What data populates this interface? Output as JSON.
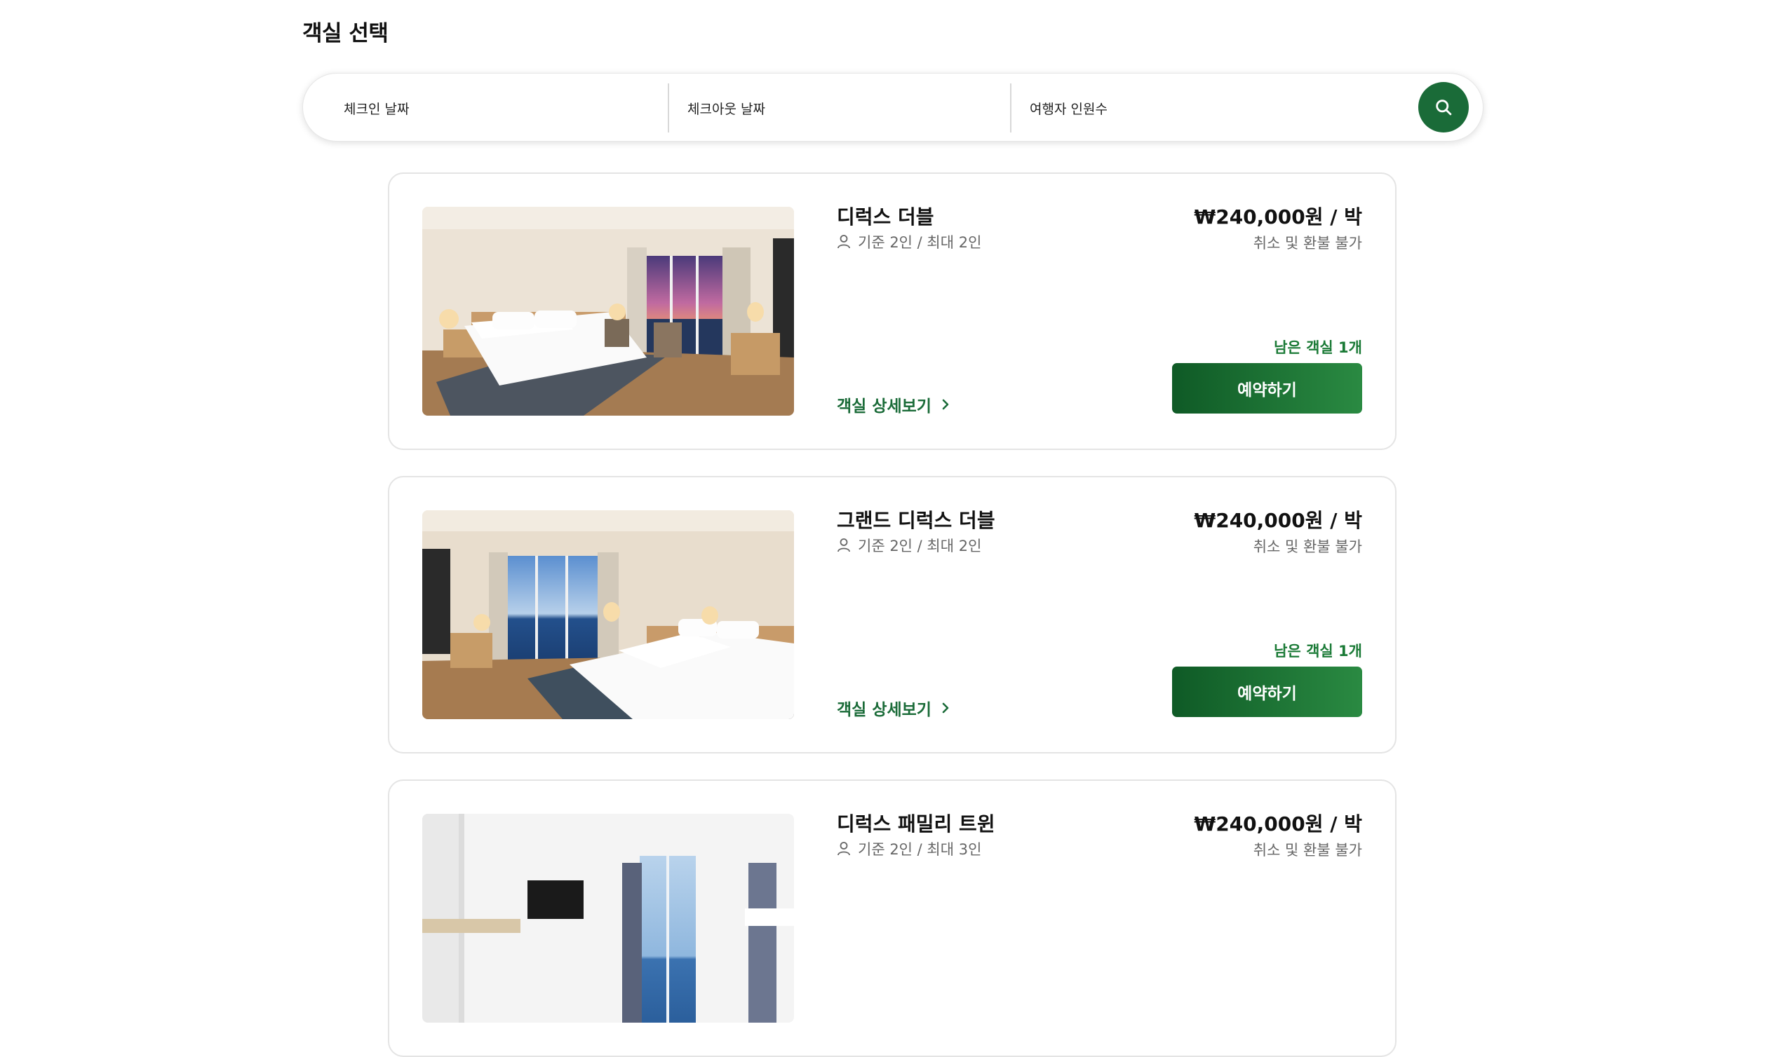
{
  "page": {
    "title": "객실 선택"
  },
  "search": {
    "checkin_placeholder": "체크인 날짜",
    "checkout_placeholder": "체크아웃 날짜",
    "guests_placeholder": "여행자 인원수"
  },
  "rooms": [
    {
      "name": "디럭스 더블",
      "capacity": "기준 2인 / 최대 2인",
      "price": "₩240,000원 / 박",
      "policy": "취소 및 환불 불가",
      "remaining": "남은 객실 1개",
      "detail_label": "객실 상세보기",
      "reserve_label": "예약하기"
    },
    {
      "name": "그랜드 디럭스 더블",
      "capacity": "기준 2인 / 최대 2인",
      "price": "₩240,000원 / 박",
      "policy": "취소 및 환불 불가",
      "remaining": "남은 객실 1개",
      "detail_label": "객실 상세보기",
      "reserve_label": "예약하기"
    },
    {
      "name": "디럭스 패밀리 트윈",
      "capacity": "기준 2인 / 최대 3인",
      "price": "₩240,000원 / 박",
      "policy": "취소 및 환불 불가"
    }
  ],
  "colors": {
    "accent": "#1a6b38",
    "remaining_text": "#1a7a36"
  },
  "icons": {
    "search": "search-icon",
    "person": "person-icon",
    "chevron": "chevron-right-icon"
  }
}
